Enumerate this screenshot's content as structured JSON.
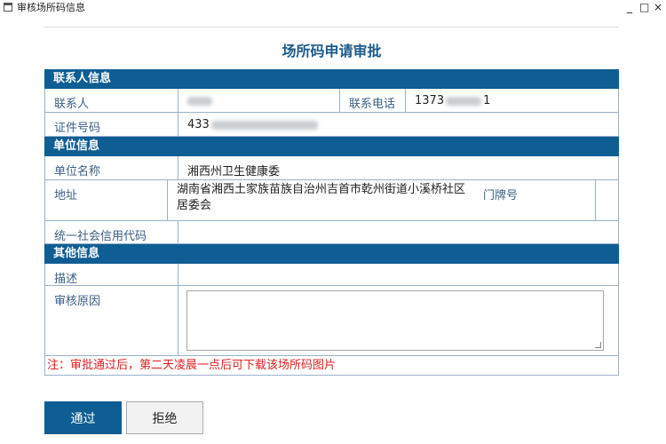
{
  "window": {
    "title": "审核场所码信息",
    "controls": [
      "_",
      "□",
      "×"
    ]
  },
  "form_title": "场所码申请审批",
  "sections": {
    "contact": "联系人信息",
    "unit": "单位信息",
    "other": "其他信息"
  },
  "contact": {
    "name_label": "联系人",
    "phone_label": "联系电话",
    "phone_prefix": "1373",
    "phone_suffix": "1",
    "id_label": "证件号码",
    "id_prefix": "433"
  },
  "unit": {
    "name_label": "单位名称",
    "name_value": "湘西州卫生健康委",
    "address_label": "地址",
    "address_value": "湖南省湘西土家族苗族自治州吉首市乾州街道小溪桥社区居委会",
    "door_label": "门牌号",
    "credit_label": "统一社会信用代码"
  },
  "other": {
    "desc_label": "描述",
    "reason_label": "审核原因"
  },
  "note": "注：审批通过后，第二天凌晨一点后可下载该场所码图片",
  "buttons": {
    "pass": "通过",
    "reject": "拒绝"
  }
}
